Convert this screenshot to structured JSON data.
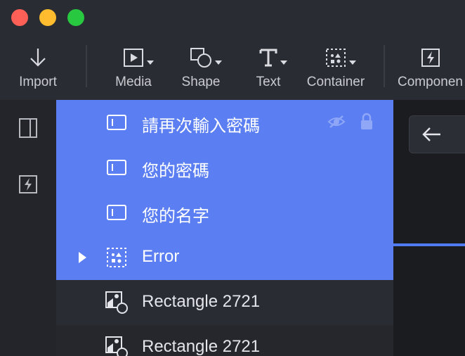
{
  "window": {
    "traffic_lights": {
      "close": "#fe5f57",
      "minimize": "#febc2e",
      "zoom": "#28c840"
    }
  },
  "toolbar": {
    "items": [
      {
        "label": "Import",
        "icon": "arrow-down-icon"
      },
      {
        "label": "Media",
        "icon": "media-icon"
      },
      {
        "label": "Shape",
        "icon": "shape-icon"
      },
      {
        "label": "Text",
        "icon": "text-icon"
      },
      {
        "label": "Container",
        "icon": "container-icon"
      },
      {
        "label": "Componen",
        "icon": "component-icon"
      }
    ]
  },
  "left_rail": {
    "icons": [
      "panel-layout-icon",
      "component-icon"
    ]
  },
  "layers": [
    {
      "name": "請再次輸入密碼",
      "icon": "text-input-icon",
      "selected": true,
      "hidden": true,
      "locked": true
    },
    {
      "name": "您的密碼",
      "icon": "text-input-icon",
      "selected": true
    },
    {
      "name": "您的名字",
      "icon": "text-input-icon",
      "selected": true
    },
    {
      "name": "Error",
      "icon": "container-icon",
      "selected": true,
      "collapsed": true
    },
    {
      "name": "Rectangle 2721",
      "icon": "image-shape-icon",
      "selected": false
    },
    {
      "name": "Rectangle 2721",
      "icon": "image-shape-icon",
      "selected": false
    }
  ],
  "colors": {
    "accent": "#5b7ff2",
    "toolbar_bg": "#2a2c33",
    "text": "#c9cbd1"
  }
}
